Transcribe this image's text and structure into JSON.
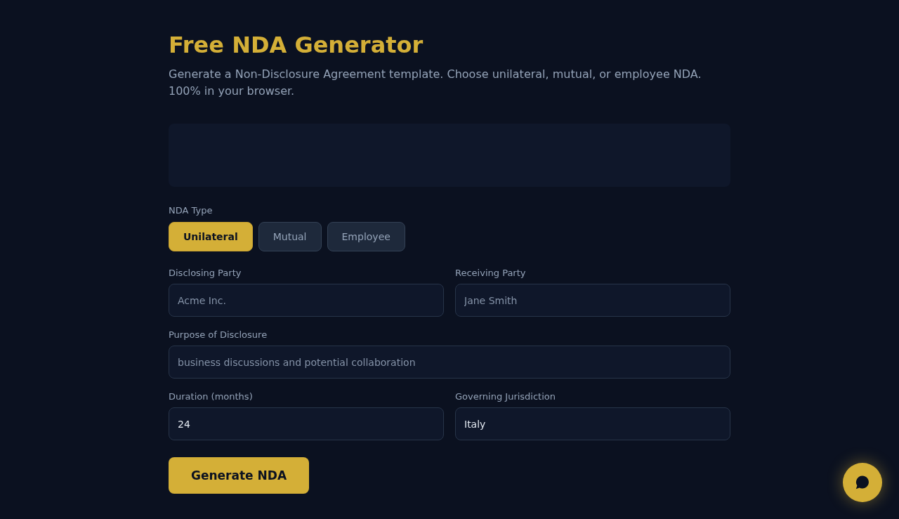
{
  "header": {
    "title": "Free NDA Generator",
    "subtitle": "Generate a Non-Disclosure Agreement template. Choose unilateral, mutual, or employee NDA. 100% in your browser."
  },
  "nda_type": {
    "label": "NDA Type",
    "options": [
      {
        "label": "Unilateral",
        "selected": true
      },
      {
        "label": "Mutual",
        "selected": false
      },
      {
        "label": "Employee",
        "selected": false
      }
    ]
  },
  "form_rows": [
    [
      {
        "label": "Disclosing Party",
        "placeholder": "Acme Inc."
      },
      {
        "label": "Receiving Party",
        "placeholder": "Jane Smith"
      }
    ],
    [
      {
        "label": "Purpose of Disclosure",
        "placeholder": "business discussions and potential collaboration"
      }
    ],
    [
      {
        "label": "Duration (months)",
        "value": "24"
      },
      {
        "label": "Governing Jurisdiction",
        "value": "Italy"
      }
    ]
  ],
  "generate_button": {
    "label": "Generate NDA"
  }
}
